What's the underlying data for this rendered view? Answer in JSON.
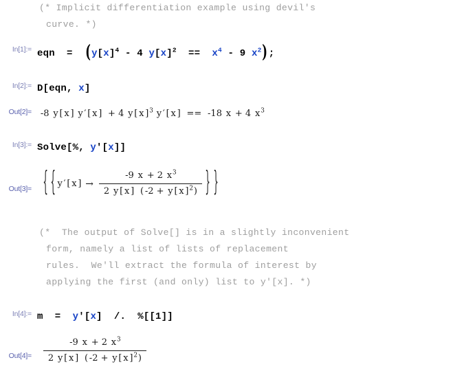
{
  "notebook": {
    "title": "Mathematica notebook session",
    "background_color": "#ffffff",
    "label_color": "#7b7fb5",
    "symbol_color": "#1743c6",
    "comment_color": "#9e9e9e",
    "output_color": "#1a1a1a"
  },
  "cells": {
    "comment1": {
      "line1": "(* Implicit differentiation example using devil's",
      "line2": "curve. *)"
    },
    "in1": {
      "label": "In[1]:=",
      "lead": "eqn  =  ",
      "y1": "y",
      "bx1": "[",
      "x1": "x",
      "bx1b": "]",
      "exp1": "4",
      "op1": " - 4 ",
      "y2": "y",
      "bx2": "[",
      "x2": "x",
      "bx2b": "]",
      "exp2": "2",
      "eq": "  ==  ",
      "x3": "x",
      "exp3": "4",
      "op2": " - 9 ",
      "x4": "x",
      "exp4": "2",
      "tail": ";"
    },
    "in2": {
      "label": "In[2]:=",
      "lead": "D[eqn, ",
      "x": "x",
      "tail": "]"
    },
    "out2": {
      "label": "Out[2]=",
      "t1": "-8",
      "t2": "y",
      "t3": "[",
      "t4": "x",
      "t5": "]",
      "t6": "y",
      "t7": "′",
      "t8": "[",
      "t9": "x",
      "t10": "]",
      "t11": "+ 4",
      "t12": "y",
      "t13": "[",
      "t14": "x",
      "t15": "]",
      "e1": "3",
      "t16": "y",
      "t17": "′",
      "t18": "[",
      "t19": "x",
      "t20": "]",
      "t21": "==",
      "t22": "-18",
      "t23": "x",
      "t24": "+ 4",
      "t25": "x",
      "e2": "3"
    },
    "in3": {
      "label": "In[3]:=",
      "lead": "Solve[%, ",
      "y": "y",
      "prime": "'",
      "b1": "[",
      "x": "x",
      "tail": "]]"
    },
    "out3": {
      "label": "Out[3]=",
      "brace_open1": "{",
      "brace_open2": "{",
      "yprime": "y",
      "prime": "′",
      "lb": "[",
      "x": "x",
      "rb": "]",
      "arrow": "→",
      "num_a": "-9",
      "num_x1": "x",
      "num_plus": "+ 2",
      "num_x2": "x",
      "num_exp": "3",
      "den_2": "2",
      "den_y": "y",
      "den_lb": "[",
      "den_x": "x",
      "den_rb": "]",
      "den_paren_l": "(",
      "den_m2": "-2 +",
      "den_y2": "y",
      "den_lb2": "[",
      "den_x2": "x",
      "den_rb2": "]",
      "den_exp": "2",
      "den_paren_r": ")",
      "brace_close1": "}",
      "brace_close2": "}"
    },
    "comment2": {
      "line1": "(*  The output of Solve[] is in a slightly inconvenient",
      "line2": "form, namely a list of lists of replacement",
      "line3": "rules.  We'll extract the formula of interest by",
      "line4": "applying the first (and only) list to y'[x]. *)"
    },
    "in4": {
      "label": "In[4]:=",
      "lead": "m  =  ",
      "y": "y",
      "prime": "'",
      "b1": "[",
      "x": "x",
      "tail": "]  /.  %[[1]]"
    },
    "out4": {
      "label": "Out[4]=",
      "num_a": "-9",
      "num_x1": "x",
      "num_plus": "+ 2",
      "num_x2": "x",
      "num_exp": "3",
      "den_2": "2",
      "den_y": "y",
      "den_lb": "[",
      "den_x": "x",
      "den_rb": "]",
      "den_paren_l": "(",
      "den_m2": "-2 +",
      "den_y2": "y",
      "den_lb2": "[",
      "den_x2": "x",
      "den_rb2": "]",
      "den_exp": "2",
      "den_paren_r": ")"
    }
  }
}
